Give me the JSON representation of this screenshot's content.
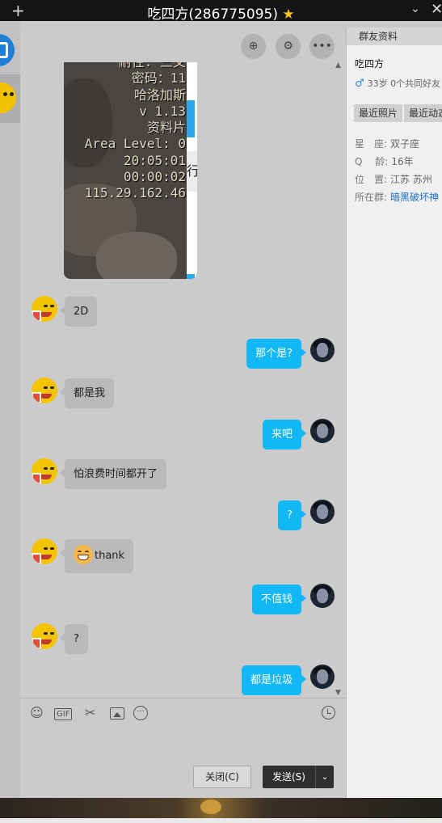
{
  "window": {
    "title": "吃四方(286775095)",
    "star": "★",
    "plus_icon": "+",
    "chevron_icon": "⌄",
    "close_icon": "✕"
  },
  "chat": {
    "screenshot_lines": [
      "耐性: 三叉",
      "密码：11",
      "哈洛加斯",
      "v 1.13",
      "资料片",
      "Area Level: 0",
      "20:05:01",
      "00:00:02",
      "115.29.162.46"
    ],
    "screenshot_strip_text": "行",
    "messages": [
      {
        "side": "left",
        "text": "2D"
      },
      {
        "side": "right",
        "text": "那个是?"
      },
      {
        "side": "left",
        "text": "都是我"
      },
      {
        "side": "right",
        "text": "来吧"
      },
      {
        "side": "left",
        "text": "怕浪费时间都开了"
      },
      {
        "side": "right",
        "text": "?"
      },
      {
        "side": "left",
        "text": "thank"
      },
      {
        "side": "right",
        "text": "不值钱"
      },
      {
        "side": "left",
        "text": "?"
      },
      {
        "side": "right",
        "text": "都是垃圾"
      }
    ]
  },
  "toolbar": {
    "gif_label": "GIF",
    "more_label": "···",
    "close_button": "关闭(C)",
    "send_button": "发送(S)",
    "send_dropdown": "⌄"
  },
  "profile": {
    "header": "群友资料",
    "name": "吃四方",
    "male_icon": "♂",
    "meta": "33岁 0个共同好友",
    "tab_photos": "最近照片",
    "tab_activity": "最近动态",
    "zodiac_label": "星　座:",
    "zodiac_value": "双子座",
    "qage_label": "Q　 龄:",
    "qage_value": "16年",
    "location_label": "位　置:",
    "location_value": "江苏 苏州",
    "group_label": "所在群:",
    "group_value": "暗黑破坏神"
  }
}
